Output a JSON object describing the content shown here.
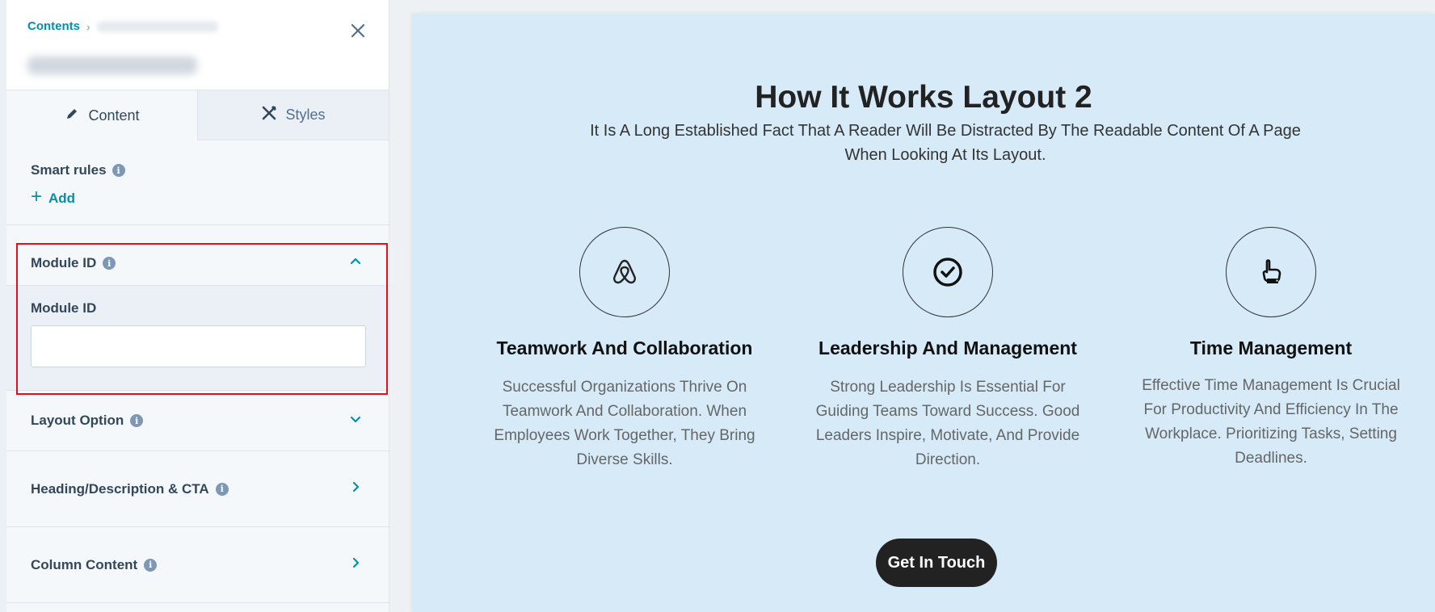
{
  "panel": {
    "breadcrumb_root": "Contents",
    "tabs": [
      {
        "label": "Content",
        "icon": "pencil-icon"
      },
      {
        "label": "Styles",
        "icon": "styles-icon"
      }
    ],
    "smart_rules": {
      "label": "Smart rules",
      "add_label": "Add"
    },
    "module_id": {
      "section_title": "Module ID",
      "field_label": "Module ID",
      "value": ""
    },
    "sections": [
      {
        "title": "Layout Option"
      },
      {
        "title": "Heading/Description & CTA"
      },
      {
        "title": "Column Content"
      }
    ]
  },
  "preview": {
    "title": "How It Works Layout 2",
    "description": "It Is A Long Established Fact That A Reader Will Be Distracted By The Readable Content Of A Page When Looking At Its Layout.",
    "features": [
      {
        "title": "Teamwork And Collaboration",
        "text": "Successful Organizations Thrive On Teamwork And Collaboration. When Employees Work Together, They Bring Diverse Skills.",
        "icon": "airbnb-icon"
      },
      {
        "title": "Leadership And Management",
        "text": "Strong Leadership Is Essential For Guiding Teams Toward Success. Good Leaders Inspire, Motivate, And Provide Direction.",
        "icon": "check-circle-icon"
      },
      {
        "title": "Time Management",
        "text": "Effective Time Management Is Crucial For Productivity And Efficiency In The Workplace. Prioritizing Tasks, Setting Deadlines.",
        "icon": "pointing-hand-icon"
      }
    ],
    "cta_label": "Get In Touch"
  },
  "colors": {
    "accent": "#0091ae",
    "highlight_border": "#e0101e",
    "preview_bg": "#d6eaf8",
    "cta_bg": "#222222"
  }
}
